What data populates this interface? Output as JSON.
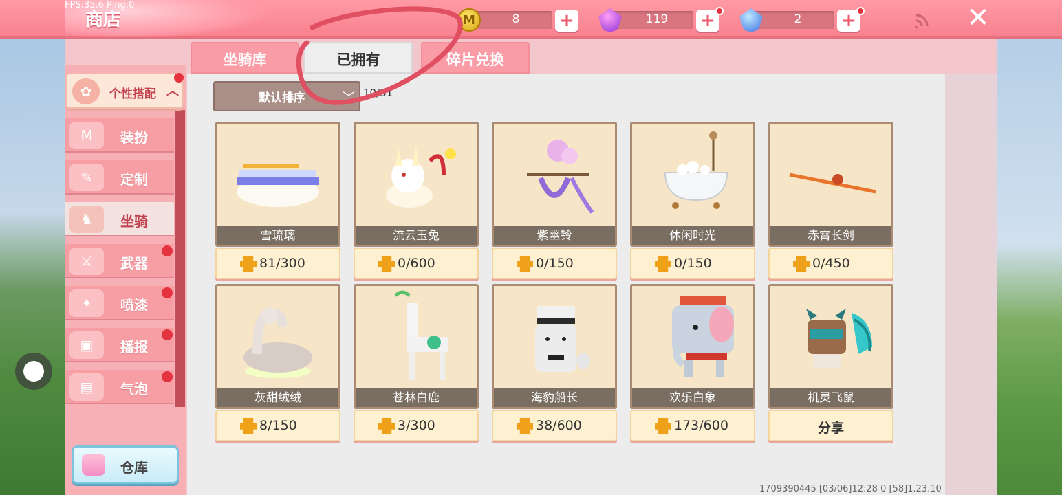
{
  "status": {
    "fps": "FPS:35.6",
    "ping": "Ping:0"
  },
  "header": {
    "title": "商店"
  },
  "currencies": [
    {
      "icon": "coin-icon",
      "amount": "8",
      "icon_text": "M"
    },
    {
      "icon": "purple-gem-icon",
      "amount": "119"
    },
    {
      "icon": "blue-gem-icon",
      "amount": "2"
    }
  ],
  "sidebar": {
    "section": "个性搭配",
    "items": [
      {
        "label": "装扮",
        "icon": "outfit-icon",
        "dot": false
      },
      {
        "label": "定制",
        "icon": "customize-icon",
        "dot": false
      },
      {
        "label": "坐骑",
        "icon": "mount-icon",
        "dot": false,
        "active": true
      },
      {
        "label": "武器",
        "icon": "weapon-icon",
        "dot": true
      },
      {
        "label": "喷漆",
        "icon": "spray-icon",
        "dot": true
      },
      {
        "label": "播报",
        "icon": "broadcast-icon",
        "dot": true
      },
      {
        "label": "气泡",
        "icon": "bubble-icon",
        "dot": true
      }
    ],
    "storage_label": "仓库"
  },
  "tabs": [
    {
      "label": "坐骑库"
    },
    {
      "label": "已拥有",
      "active": true
    },
    {
      "label": "碎片兑换"
    }
  ],
  "sort": {
    "label": "默认排序",
    "count": "10/31"
  },
  "items": [
    {
      "name": "雪琉璃",
      "progress": "81/300"
    },
    {
      "name": "流云玉兔",
      "progress": "0/600"
    },
    {
      "name": "紫幽铃",
      "progress": "0/150"
    },
    {
      "name": "休闲时光",
      "progress": "0/150"
    },
    {
      "name": "赤霄长剑",
      "progress": "0/450"
    },
    {
      "name": "灰甜绒绒",
      "progress": "8/150"
    },
    {
      "name": "苍林白鹿",
      "progress": "3/300"
    },
    {
      "name": "海豹船长",
      "progress": "38/600"
    },
    {
      "name": "欢乐白象",
      "progress": "173/600"
    },
    {
      "name": "机灵飞鼠",
      "action": "分享"
    }
  ],
  "footer": {
    "uid": "1709390445",
    "time": "[03/06]12:28 0",
    "version": "[58]1.23.10"
  },
  "colors": {
    "topbar": "#f9818f",
    "accent_red": "#e5323f",
    "card_bg": "#f6e6c7",
    "name_bar": "#7a6e63"
  }
}
